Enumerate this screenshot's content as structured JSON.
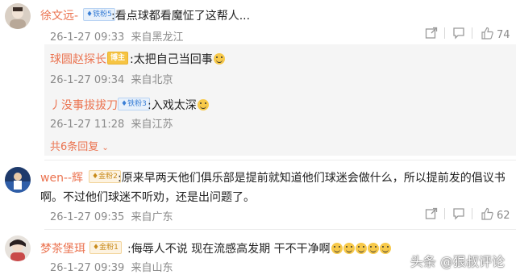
{
  "comments": [
    {
      "username": "徐文远-",
      "badge": "铁粉5",
      "text": ":看点球都看魔怔了这帮人...",
      "time": "26-1-27 09:33",
      "location": "来自黑龙江",
      "likes": "74"
    },
    {
      "username": "wen--辉",
      "badge": "金粉2",
      "text_line1": ":原来早两天他们俱乐部是提前就知道他们球迷会做什么，所以提前发的倡议书",
      "text_line2": "啊。不过他们球迷不听劝，还是出问题了。",
      "time": "26-1-27 09:35",
      "location": "来自广东",
      "likes": "62"
    },
    {
      "username": "梦茶堡珥",
      "badge": "金粉1",
      "text": ":侮辱人不说 现在流感高发期 干不干净啊",
      "time": "26-1-27 09:39",
      "location": "来自山东"
    }
  ],
  "replies": [
    {
      "username": "球圆赵探长",
      "badge": "博主",
      "text": ":太把自己当回事",
      "time": "26-1-27 09:34",
      "location": "来自北京"
    },
    {
      "username": "丿没事拔拔刀",
      "badge": "铁粉3",
      "text": ":入戏太深",
      "time": "26-1-27 11:28",
      "location": "来自江苏"
    }
  ],
  "more_replies": "共6条回复",
  "watermark": "头条 @狠叔评论",
  "icons": [
    "share-icon",
    "comment-icon",
    "like-icon",
    "fan-badge-icon",
    "smile-emoji-icon"
  ],
  "colors": {
    "username": "#eb7350",
    "meta": "#8a8a8a",
    "reply_bg": "#f5f5f5"
  }
}
